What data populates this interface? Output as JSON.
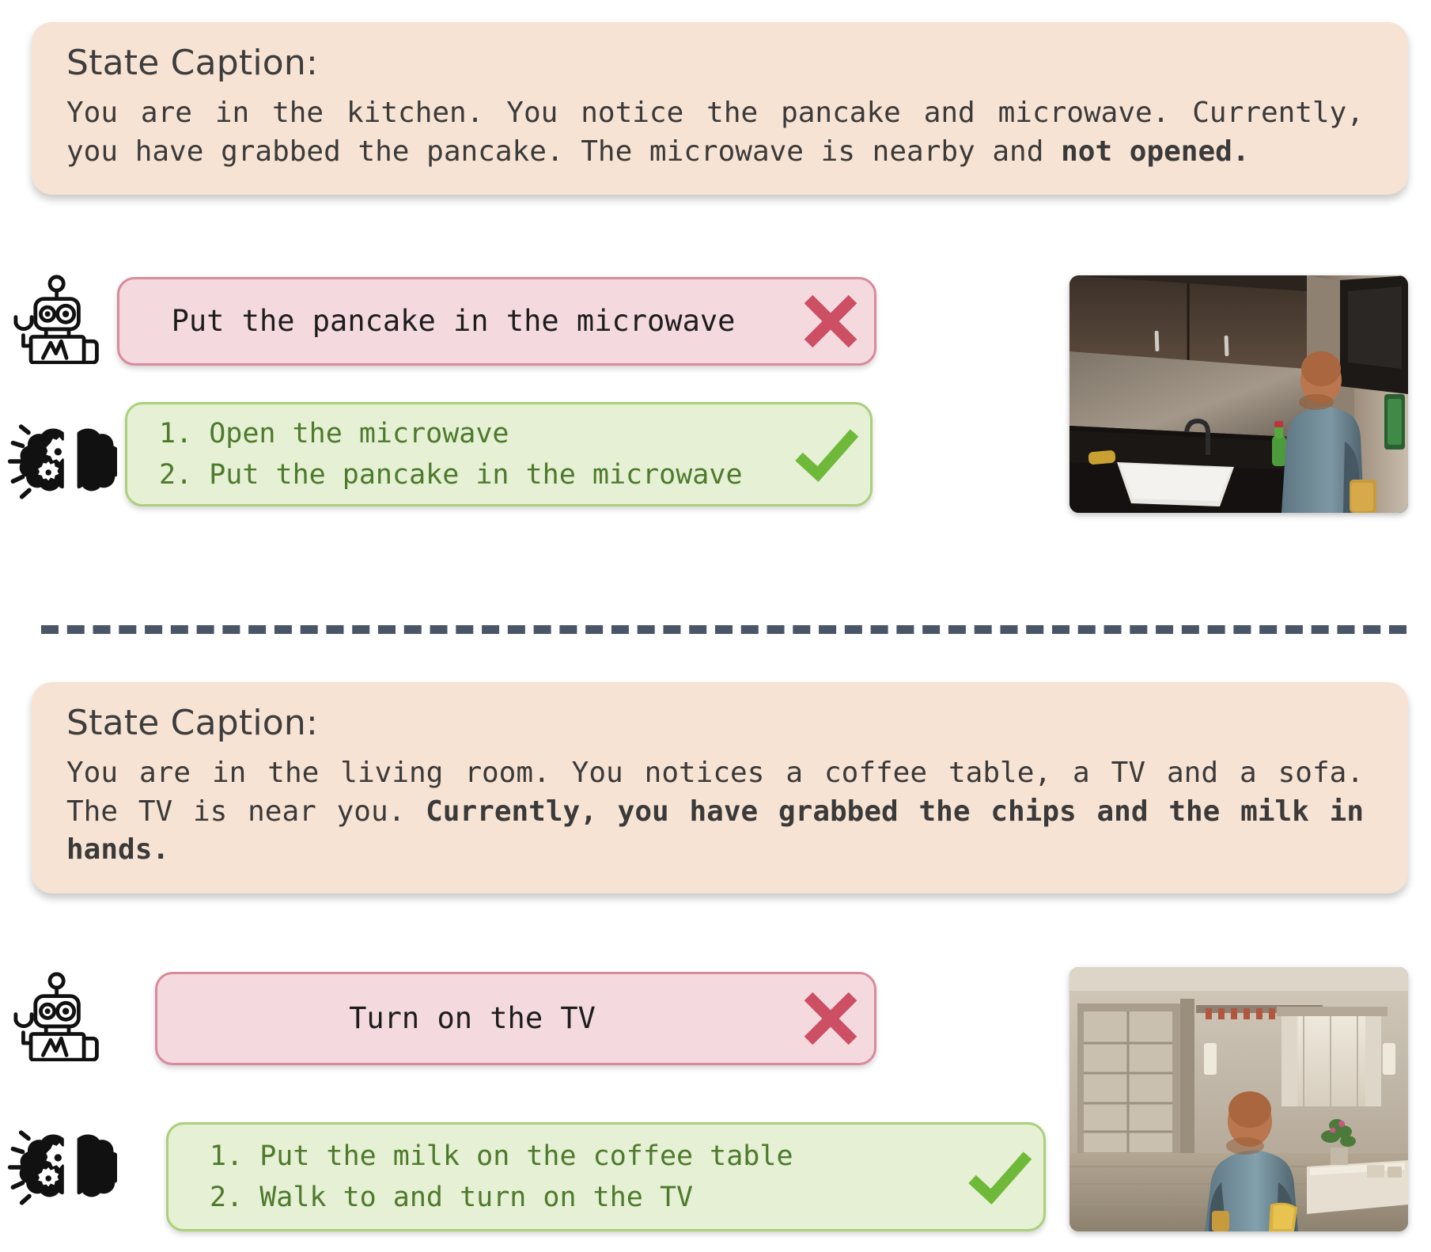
{
  "sections": [
    {
      "caption": {
        "title": "State Caption:",
        "text_plain_1": "You are in the kitchen. You notice the pancake and microwave. Currently, you have grabbed the pancake. The microwave is nearby and ",
        "text_bold_1": "not opened.",
        "full_text": "You are in the kitchen. You notice the pancake and microwave. Currently, you have grabbed the pancake. The microwave is nearby and not opened."
      },
      "agent": {
        "icon": "robot-icon",
        "action": "Put the pancake in the microwave",
        "verdict": "incorrect",
        "mark": "cross-icon"
      },
      "reasoner": {
        "icon": "brain-gears-icon",
        "steps": [
          "1. Open the microwave",
          "2. Put the pancake in the microwave"
        ],
        "verdict": "correct",
        "mark": "check-icon"
      },
      "scene": {
        "name": "kitchen-scene-thumbnail",
        "description": "Virtual home kitchen with dark upper cabinets, sink, green bottle, and a character in a blue shirt facing a microwave"
      }
    },
    {
      "caption": {
        "title": "State Caption:",
        "text_plain_1": "You are in the living room. You notices a coffee table, a TV and a sofa. The TV is near you. ",
        "text_bold_1": "Currently, you have grabbed the chips and the milk in hands.",
        "full_text": "You are in the living room. You notices a coffee table, a TV and a sofa. The TV is near you. Currently, you have grabbed the chips and the milk in hands."
      },
      "agent": {
        "icon": "robot-icon",
        "action": "Turn on the TV",
        "verdict": "incorrect",
        "mark": "cross-icon"
      },
      "reasoner": {
        "icon": "brain-gears-icon",
        "steps": [
          "1. Put the milk on the coffee table",
          "2. Walk to and turn on the TV"
        ],
        "verdict": "correct",
        "mark": "check-icon"
      },
      "scene": {
        "name": "living-room-scene-thumbnail",
        "description": "Virtual home living room with shelving, curtained window, coffee table with plant, and a character in a blue shirt holding a yellow bag"
      }
    }
  ],
  "divider": {
    "name": "section-divider",
    "style": "dashed"
  },
  "colors": {
    "caption_bg": "#f7e3d3",
    "bad_bg": "#f4dadf",
    "bad_border": "#d98a9c",
    "cross": "#cc4f63",
    "good_bg": "#e6f0d4",
    "good_border": "#aad07a",
    "check": "#6fb93a",
    "good_text": "#4d7a2c",
    "divider": "#4a5568",
    "body_text": "#3a3a3a"
  }
}
